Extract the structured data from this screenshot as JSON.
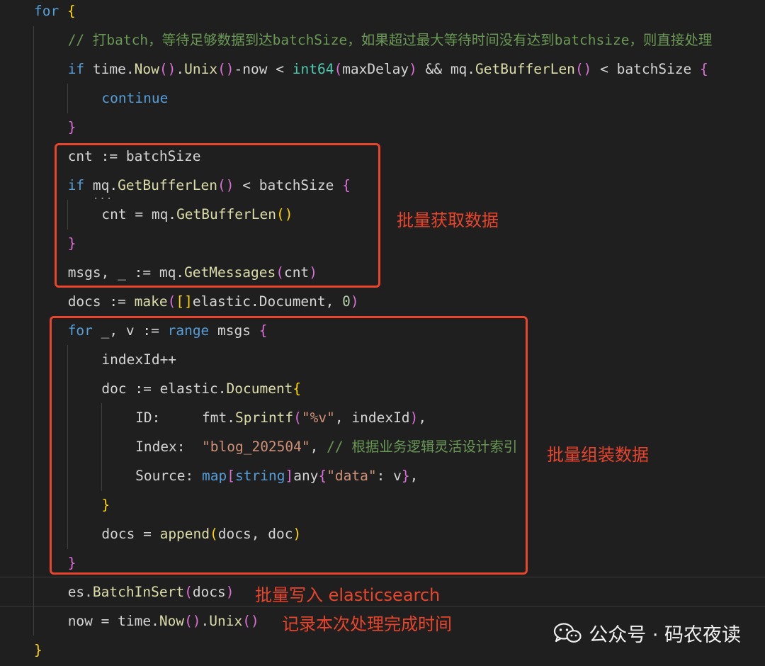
{
  "editor": {
    "lines": [
      {
        "indent": 0,
        "tokens": [
          {
            "t": "for",
            "c": "kw"
          },
          {
            "t": " "
          },
          {
            "t": "{",
            "c": "br1"
          }
        ]
      },
      {
        "indent": 1,
        "tokens": [
          {
            "t": "// 打batch，等待足够数据到达batchSize，如果超过最大等待时间没有达到batchsize，则直接处理",
            "c": "cm"
          }
        ]
      },
      {
        "indent": 1,
        "tokens": [
          {
            "t": "if",
            "c": "kw"
          },
          {
            "t": " time."
          },
          {
            "t": "Now",
            "c": "fn"
          },
          {
            "t": "()",
            "c": "br2"
          },
          {
            "t": "."
          },
          {
            "t": "Unix",
            "c": "fn"
          },
          {
            "t": "()",
            "c": "br2"
          },
          {
            "t": "-now < "
          },
          {
            "t": "int64",
            "c": "ty"
          },
          {
            "t": "(",
            "c": "br2"
          },
          {
            "t": "maxDelay"
          },
          {
            "t": ")",
            "c": "br2"
          },
          {
            "t": " && mq."
          },
          {
            "t": "GetBufferLen",
            "c": "fn"
          },
          {
            "t": "()",
            "c": "br2"
          },
          {
            "t": " < batchSize "
          },
          {
            "t": "{",
            "c": "br2"
          }
        ]
      },
      {
        "indent": 2,
        "tokens": [
          {
            "t": "continue",
            "c": "kw"
          }
        ]
      },
      {
        "indent": 1,
        "tokens": [
          {
            "t": "}",
            "c": "br2"
          }
        ]
      },
      {
        "indent": 1,
        "tokens": [
          {
            "t": "cnt := batchSize"
          }
        ]
      },
      {
        "indent": 1,
        "tokens": [
          {
            "t": "if",
            "c": "kw"
          },
          {
            "t": " mq."
          },
          {
            "t": "GetBufferLen",
            "c": "fn"
          },
          {
            "t": "()",
            "c": "br2"
          },
          {
            "t": " < batchSize "
          },
          {
            "t": "{",
            "c": "br2"
          }
        ]
      },
      {
        "indent": 2,
        "tokens": [
          {
            "t": "cnt = mq."
          },
          {
            "t": "GetBufferLen",
            "c": "fn"
          },
          {
            "t": "()",
            "c": "br1"
          }
        ]
      },
      {
        "indent": 1,
        "tokens": [
          {
            "t": "}",
            "c": "br2"
          }
        ]
      },
      {
        "indent": 1,
        "tokens": [
          {
            "t": "msgs, _ := mq."
          },
          {
            "t": "GetMessages",
            "c": "fn"
          },
          {
            "t": "(",
            "c": "br2"
          },
          {
            "t": "cnt"
          },
          {
            "t": ")",
            "c": "br2"
          }
        ]
      },
      {
        "indent": 1,
        "tokens": [
          {
            "t": "docs := "
          },
          {
            "t": "make",
            "c": "fn"
          },
          {
            "t": "(",
            "c": "br2"
          },
          {
            "t": "[]",
            "c": "br1"
          },
          {
            "t": "elastic.Document, "
          },
          {
            "t": "0",
            "c": "num"
          },
          {
            "t": ")",
            "c": "br2"
          }
        ]
      },
      {
        "indent": 1,
        "tokens": [
          {
            "t": "for",
            "c": "kw"
          },
          {
            "t": " _, v := "
          },
          {
            "t": "range",
            "c": "kw"
          },
          {
            "t": " msgs "
          },
          {
            "t": "{",
            "c": "br2"
          }
        ]
      },
      {
        "indent": 2,
        "tokens": [
          {
            "t": "indexId++"
          }
        ]
      },
      {
        "indent": 2,
        "tokens": [
          {
            "t": "doc := elastic."
          },
          {
            "t": "Document",
            "c": "fn"
          },
          {
            "t": "{",
            "c": "br1"
          }
        ]
      },
      {
        "indent": 3,
        "tokens": [
          {
            "t": "ID:     fmt."
          },
          {
            "t": "Sprintf",
            "c": "fn"
          },
          {
            "t": "(",
            "c": "br2"
          },
          {
            "t": "\"%v\"",
            "c": "str"
          },
          {
            "t": ", indexId"
          },
          {
            "t": ")",
            "c": "br2"
          },
          {
            "t": ","
          }
        ]
      },
      {
        "indent": 3,
        "tokens": [
          {
            "t": "Index:  "
          },
          {
            "t": "\"blog_202504\"",
            "c": "str"
          },
          {
            "t": ", "
          },
          {
            "t": "// 根据业务逻辑灵活设计索引",
            "c": "cm"
          }
        ]
      },
      {
        "indent": 3,
        "tokens": [
          {
            "t": "Source: "
          },
          {
            "t": "map",
            "c": "kw"
          },
          {
            "t": "[",
            "c": "br2"
          },
          {
            "t": "string",
            "c": "kw"
          },
          {
            "t": "]",
            "c": "br2"
          },
          {
            "t": "any"
          },
          {
            "t": "{",
            "c": "br2"
          },
          {
            "t": "\"data\"",
            "c": "str"
          },
          {
            "t": ": v"
          },
          {
            "t": "}",
            "c": "br2"
          },
          {
            "t": ","
          }
        ]
      },
      {
        "indent": 2,
        "tokens": [
          {
            "t": "}",
            "c": "br1"
          }
        ]
      },
      {
        "indent": 2,
        "tokens": [
          {
            "t": "docs = "
          },
          {
            "t": "append",
            "c": "fn"
          },
          {
            "t": "(",
            "c": "br1"
          },
          {
            "t": "docs, doc"
          },
          {
            "t": ")",
            "c": "br1"
          }
        ]
      },
      {
        "indent": 1,
        "tokens": [
          {
            "t": "}",
            "c": "br2"
          }
        ]
      },
      {
        "indent": 1,
        "tokens": [
          {
            "t": "es."
          },
          {
            "t": "BatchInSert",
            "c": "fn"
          },
          {
            "t": "(",
            "c": "br2"
          },
          {
            "t": "docs"
          },
          {
            "t": ")",
            "c": "br2"
          }
        ]
      },
      {
        "indent": 1,
        "tokens": [
          {
            "t": "now = time."
          },
          {
            "t": "Now",
            "c": "fn"
          },
          {
            "t": "()",
            "c": "br2"
          },
          {
            "t": "."
          },
          {
            "t": "Unix",
            "c": "fn"
          },
          {
            "t": "()",
            "c": "br2"
          }
        ]
      },
      {
        "indent": 0,
        "tokens": [
          {
            "t": "}",
            "c": "br1"
          }
        ]
      }
    ]
  },
  "annotations": {
    "fetch": "批量获取数据",
    "assemble": "批量组装数据",
    "insert": "批量写入 elasticsearch",
    "record": "记录本次处理完成时间"
  },
  "watermark": {
    "text": "公众号 · 码农夜读",
    "icon": "wechat-icon"
  },
  "colors": {
    "background": "#1f1f1f",
    "annotation": "#e8452c",
    "keyword": "#569cd6",
    "function": "#dcdcaa",
    "comment": "#6a9955",
    "string": "#ce9178"
  }
}
